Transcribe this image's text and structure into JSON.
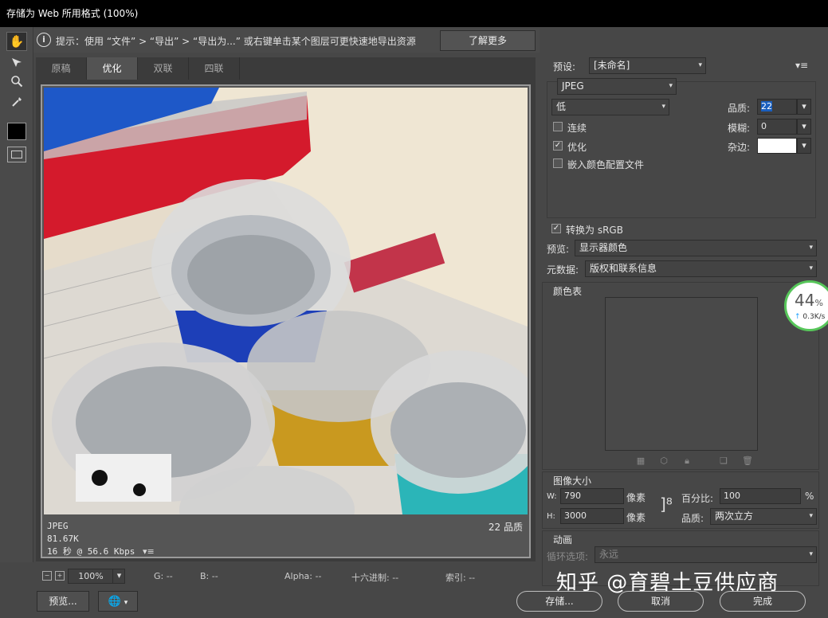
{
  "window": {
    "title": "存储为 Web 所用格式 (100%)"
  },
  "tools": {
    "hand": "hand-icon",
    "slice_select": "slice-select-icon",
    "zoom": "zoom-icon",
    "eyedropper": "eyedropper-icon",
    "color_swatch": "#000000"
  },
  "hint": {
    "icon": "info-icon",
    "text": "提示：使用 “文件” > “导出” > “导出为...” 或右键单击某个图层可更快速地导出资源",
    "learn_more": "了解更多"
  },
  "tabs": [
    {
      "label": "原稿",
      "active": false
    },
    {
      "label": "优化",
      "active": true
    },
    {
      "label": "双联",
      "active": false
    },
    {
      "label": "四联",
      "active": false
    }
  ],
  "image_info": {
    "format": "JPEG",
    "size": "81.67K",
    "time": "16 秒 @ 56.6 Kbps",
    "quality": "22 品质",
    "menu_icon": "▾≡"
  },
  "statusbar": {
    "zoom": "100%",
    "g": "G: --",
    "b": "B: --",
    "alpha": "Alpha: --",
    "hex": "十六进制: --",
    "index": "索引: --"
  },
  "bottom_buttons": {
    "preview": "预览...",
    "browser_icon": "browser-icon",
    "save": "存储...",
    "cancel": "取消",
    "done": "完成"
  },
  "settings": {
    "preset_label": "预设:",
    "preset_value": "[未命名]",
    "format": "JPEG",
    "quality_level": "低",
    "quality_label": "品质:",
    "quality_value": "22",
    "blur_label": "模糊:",
    "blur_value": "0",
    "matte_label": "杂边:",
    "progressive": {
      "label": "连续",
      "checked": false
    },
    "optimized": {
      "label": "优化",
      "checked": true
    },
    "embed_profile": {
      "label": "嵌入颜色配置文件",
      "checked": false
    },
    "convert_srgb": {
      "label": "转换为 sRGB",
      "checked": true
    },
    "preview_label": "预览:",
    "preview_value": "显示器颜色",
    "metadata_label": "元数据:",
    "metadata_value": "版权和联系信息"
  },
  "color_table": {
    "title": "颜色表"
  },
  "image_size": {
    "title": "图像大小",
    "w_label": "W:",
    "w_value": "790",
    "h_label": "H:",
    "h_value": "3000",
    "unit": "像素",
    "percent_label": "百分比:",
    "percent_value": "100",
    "percent_unit": "%",
    "quality_label": "品质:",
    "quality_value": "两次立方"
  },
  "animation": {
    "title": "动画",
    "loop_label": "循环选项:",
    "loop_value": "永远"
  },
  "speed_widget": {
    "percent": "44",
    "percent_sign": "%",
    "rate": "0.3K/s"
  },
  "watermark": "知乎 @育碧土豆供应商"
}
